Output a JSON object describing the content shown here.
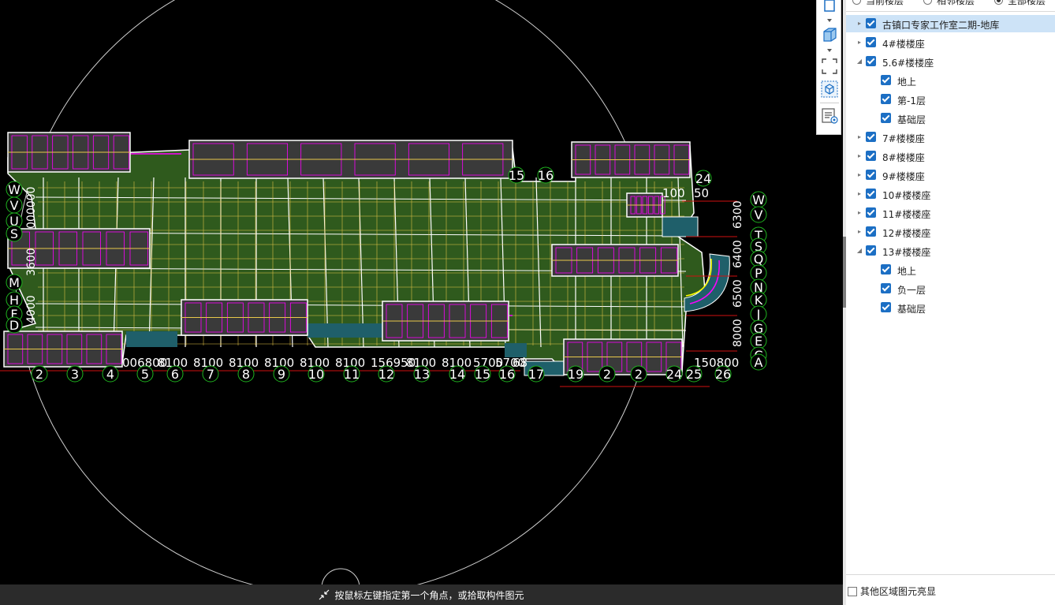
{
  "status_bar": {
    "prompt": "按鼠标左键指定第一个角点，或拾取构件图元"
  },
  "floor_scope": {
    "options": [
      "当前楼层",
      "相邻楼层",
      "全部楼层"
    ],
    "selected": "全部楼层"
  },
  "tree": {
    "items": [
      {
        "label": "古镇口专家工作室二期-地库",
        "level": 0,
        "expander": "collapsed",
        "checked": true,
        "selected": true
      },
      {
        "label": "4#楼楼座",
        "level": 1,
        "expander": "collapsed",
        "checked": true
      },
      {
        "label": "5.6#楼楼座",
        "level": 1,
        "expander": "expanded",
        "checked": true
      },
      {
        "label": "地上",
        "level": 2,
        "expander": "none",
        "checked": true
      },
      {
        "label": "第-1层",
        "level": 2,
        "expander": "none",
        "checked": true
      },
      {
        "label": "基础层",
        "level": 2,
        "expander": "none",
        "checked": true
      },
      {
        "label": "7#楼楼座",
        "level": 1,
        "expander": "collapsed",
        "checked": true
      },
      {
        "label": "8#楼楼座",
        "level": 1,
        "expander": "collapsed",
        "checked": true
      },
      {
        "label": "9#楼楼座",
        "level": 1,
        "expander": "collapsed",
        "checked": true
      },
      {
        "label": "10#楼楼座",
        "level": 1,
        "expander": "collapsed",
        "checked": true
      },
      {
        "label": "11#楼楼座",
        "level": 1,
        "expander": "collapsed",
        "checked": true
      },
      {
        "label": "12#楼楼座",
        "level": 1,
        "expander": "collapsed",
        "checked": true
      },
      {
        "label": "13#楼楼座",
        "level": 1,
        "expander": "expanded",
        "checked": true
      },
      {
        "label": "地上",
        "level": 2,
        "expander": "none",
        "checked": true
      },
      {
        "label": "负一层",
        "level": 2,
        "expander": "none",
        "checked": true
      },
      {
        "label": "基础层",
        "level": 2,
        "expander": "none",
        "checked": true
      }
    ]
  },
  "other_area": {
    "label": "其他区域图元亮显",
    "checked": false
  },
  "toolbar_icons": [
    "cube-outline-icon",
    "cube-filled-icon",
    "fit-view-icon",
    "view-3d-icon",
    "display-settings-icon"
  ],
  "drawing": {
    "bottom_dims": [
      "006800",
      "8100",
      "8100",
      "8100",
      "8100",
      "8100",
      "8100",
      "156950",
      "8100",
      "8100",
      "5700",
      "5700",
      "68",
      "150800"
    ],
    "bottom_axes": [
      "2",
      "3",
      "4",
      "5",
      "6",
      "7",
      "8",
      "9",
      "10",
      "11",
      "12",
      "13",
      "14",
      "15",
      "16",
      "17",
      "19",
      "2",
      "2",
      "24",
      "25",
      "26"
    ],
    "top_axes": [
      "15",
      "16",
      "24"
    ],
    "right_axes": [
      "W",
      "V",
      "T",
      "S",
      "Q",
      "P",
      "N",
      "K",
      "J",
      "G",
      "E",
      "C",
      "A"
    ],
    "left_axes": [
      "W",
      "V",
      "U",
      "S",
      "M",
      "H",
      "F",
      "D"
    ],
    "left_vertical_dims": [
      "000000",
      "3600",
      "4000"
    ],
    "right_vertical_dims": [
      "6300",
      "6400",
      "6500",
      "8000"
    ],
    "top_dims": [
      "100",
      "50"
    ],
    "colors": {
      "slab": "#2f5a1d",
      "beam": "#e8c84a",
      "wall": "#ffffff",
      "pipe": "#ff00ff",
      "axis": "#d01010",
      "hl": "#ffff00",
      "water": "#1f5f6a"
    }
  }
}
